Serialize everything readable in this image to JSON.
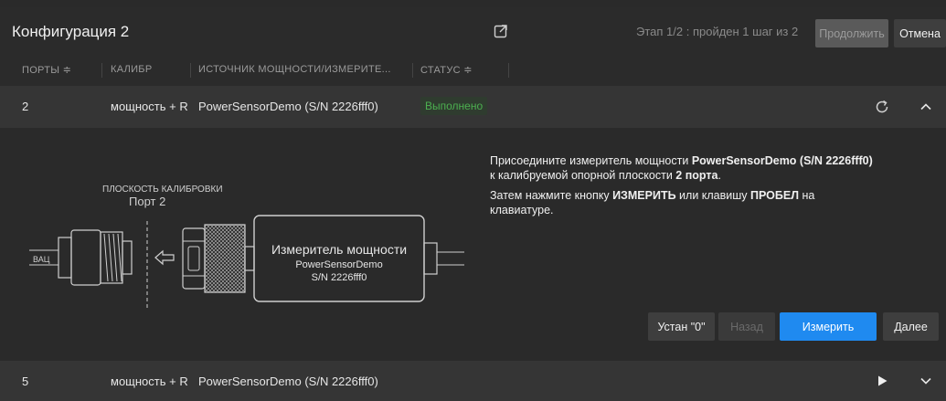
{
  "header": {
    "title": "Конфигурация 2",
    "stage_text": "Этап 1/2 : пройден 1 шаг из 2",
    "continue_label": "Продолжить",
    "cancel_label": "Отмена"
  },
  "columns": [
    {
      "label": "ПОРТЫ ≑"
    },
    {
      "label": "КАЛИБР"
    },
    {
      "label": "ИСТОЧНИК МОЩНОСТИ/ИЗМЕРИТЕ..."
    },
    {
      "label": "СТАТУС ≑"
    }
  ],
  "rows": [
    {
      "port": "2",
      "calib": "мощность + R",
      "source": "PowerSensorDemo (S/N 2226fff0)",
      "status": "Выполнено",
      "status_color": "#4caf50"
    },
    {
      "port": "5",
      "calib": "мощность + R",
      "source": "PowerSensorDemo (S/N 2226fff0)",
      "status": ""
    }
  ],
  "diagram": {
    "plane_label": "ПЛОСКОСТЬ КАЛИБРОВКИ",
    "port_label": "Порт 2",
    "vna_label": "ВАЦ",
    "meter_title": "Измеритель мощности",
    "meter_model": "PowerSensorDemo",
    "meter_serial": "S/N 2226fff0"
  },
  "instructions": {
    "l1_pre": "Присоедините измеритель мощности ",
    "l1_bold": "PowerSensorDemo (S/N 2226fff0)",
    "l2_pre": "к калибруемой опорной плоскости ",
    "l2_bold": "2 порта",
    "l2_post": ".",
    "l3_pre": "Затем нажмите кнопку ",
    "l3_bold1": "ИЗМЕРИТЬ",
    "l3_mid": " или клавишу ",
    "l3_bold2": "ПРОБЕЛ",
    "l3_post": " на",
    "l4": "клавиатуре."
  },
  "actions": {
    "zero_label": "Устан \"0\"",
    "back_label": "Назад",
    "measure_label": "Измерить",
    "next_label": "Далее"
  },
  "icons": {
    "open_external": "open-external-icon",
    "refresh": "refresh-icon",
    "collapse": "chevron-up-icon",
    "play": "play-icon",
    "expand": "chevron-down-icon"
  },
  "colors": {
    "accent": "#1f8af0",
    "success": "#4caf50"
  }
}
